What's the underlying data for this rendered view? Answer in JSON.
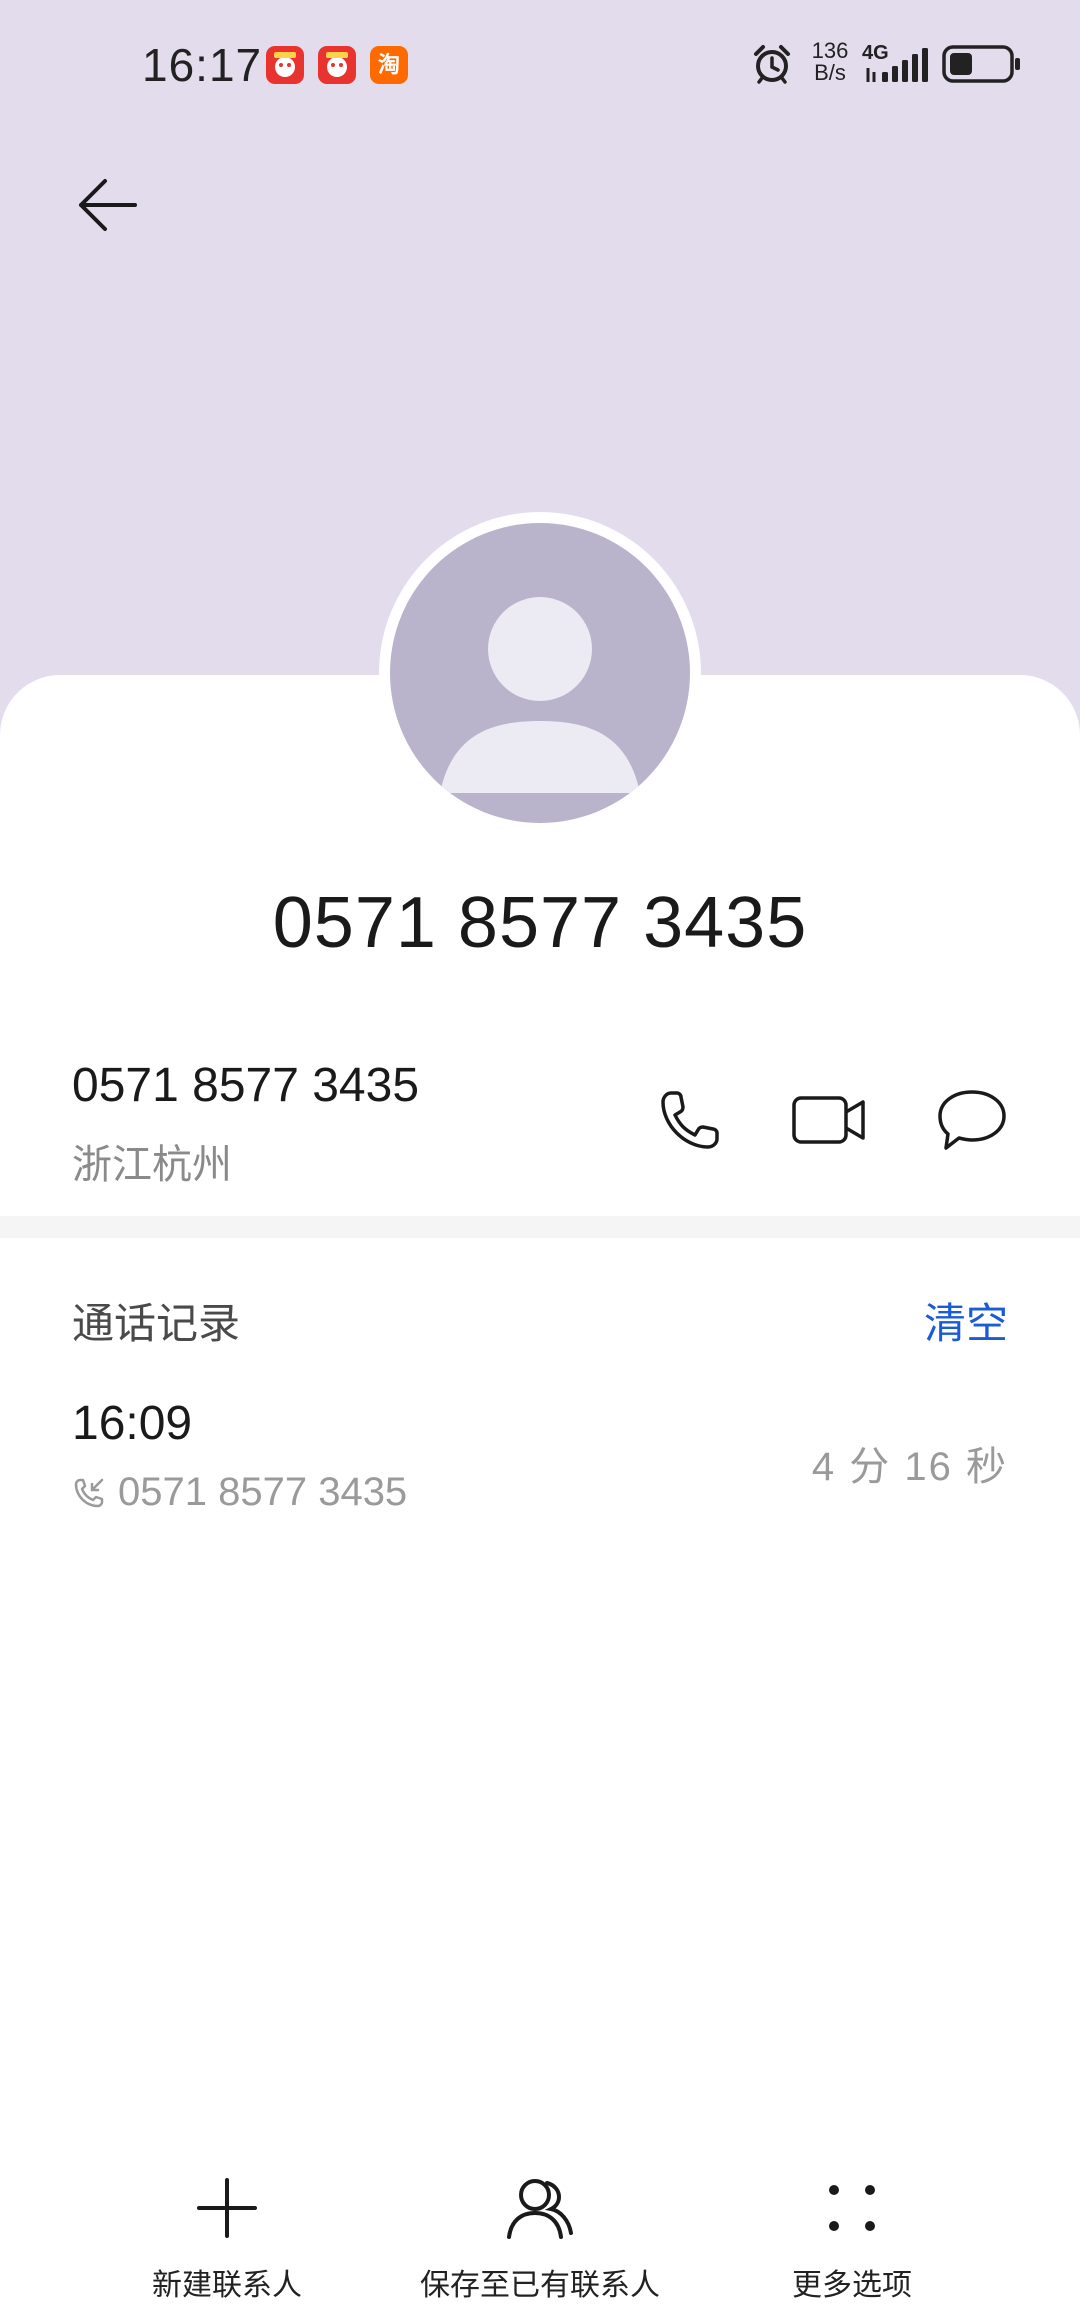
{
  "status_bar": {
    "time": "16:17",
    "app_icons": [
      {
        "name": "pinduoduo-app-icon",
        "label": "拼多多",
        "color": "#e8332e"
      },
      {
        "name": "pinduoduo-app-icon-2",
        "label": "拼多多",
        "color": "#e8332e"
      },
      {
        "name": "taobao-app-icon",
        "label": "淘",
        "color": "#ff6a00"
      }
    ],
    "net_speed_value": "136",
    "net_speed_unit": "B/s",
    "network_type": "4G",
    "icons": [
      "alarm-icon",
      "signal-icon",
      "battery-icon"
    ]
  },
  "header": {
    "back_icon": "arrow-left-icon",
    "background_color": "#e2dced"
  },
  "contact": {
    "display_number": "0571 8577 3435",
    "number": "0571 8577 3435",
    "location": "浙江杭州",
    "actions": [
      "phone-icon",
      "video-call-icon",
      "message-icon"
    ]
  },
  "call_log": {
    "title": "通话记录",
    "clear_label": "清空",
    "clear_color": "#1a5bd6",
    "items": [
      {
        "time": "16:09",
        "number": "0571 8577 3435",
        "duration": "4 分 16 秒",
        "direction_icon": "incoming-call-icon"
      }
    ]
  },
  "bottom_bar": {
    "new_contact": "新建联系人",
    "save_to_existing": "保存至已有联系人",
    "more_options": "更多选项"
  }
}
